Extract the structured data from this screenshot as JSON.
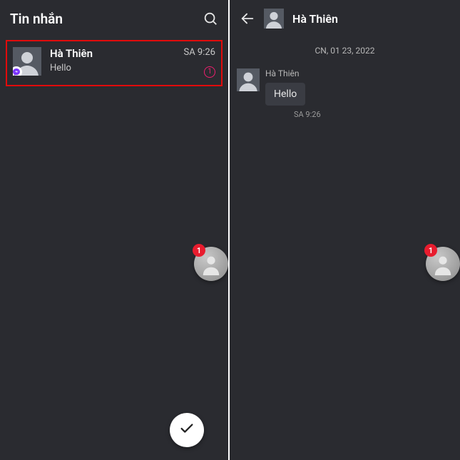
{
  "left": {
    "title": "Tin nhắn",
    "conversations": [
      {
        "name": "Hà Thiên",
        "preview": "Hello",
        "time": "SA 9:26",
        "unread": "1"
      }
    ],
    "chathead_badge": "1"
  },
  "right": {
    "header_name": "Hà Thiên",
    "date_separator": "CN, 01 23, 2022",
    "messages": [
      {
        "sender": "Hà Thiên",
        "text": "Hello",
        "time": "SA 9:26"
      }
    ],
    "chathead_badge": "1"
  }
}
